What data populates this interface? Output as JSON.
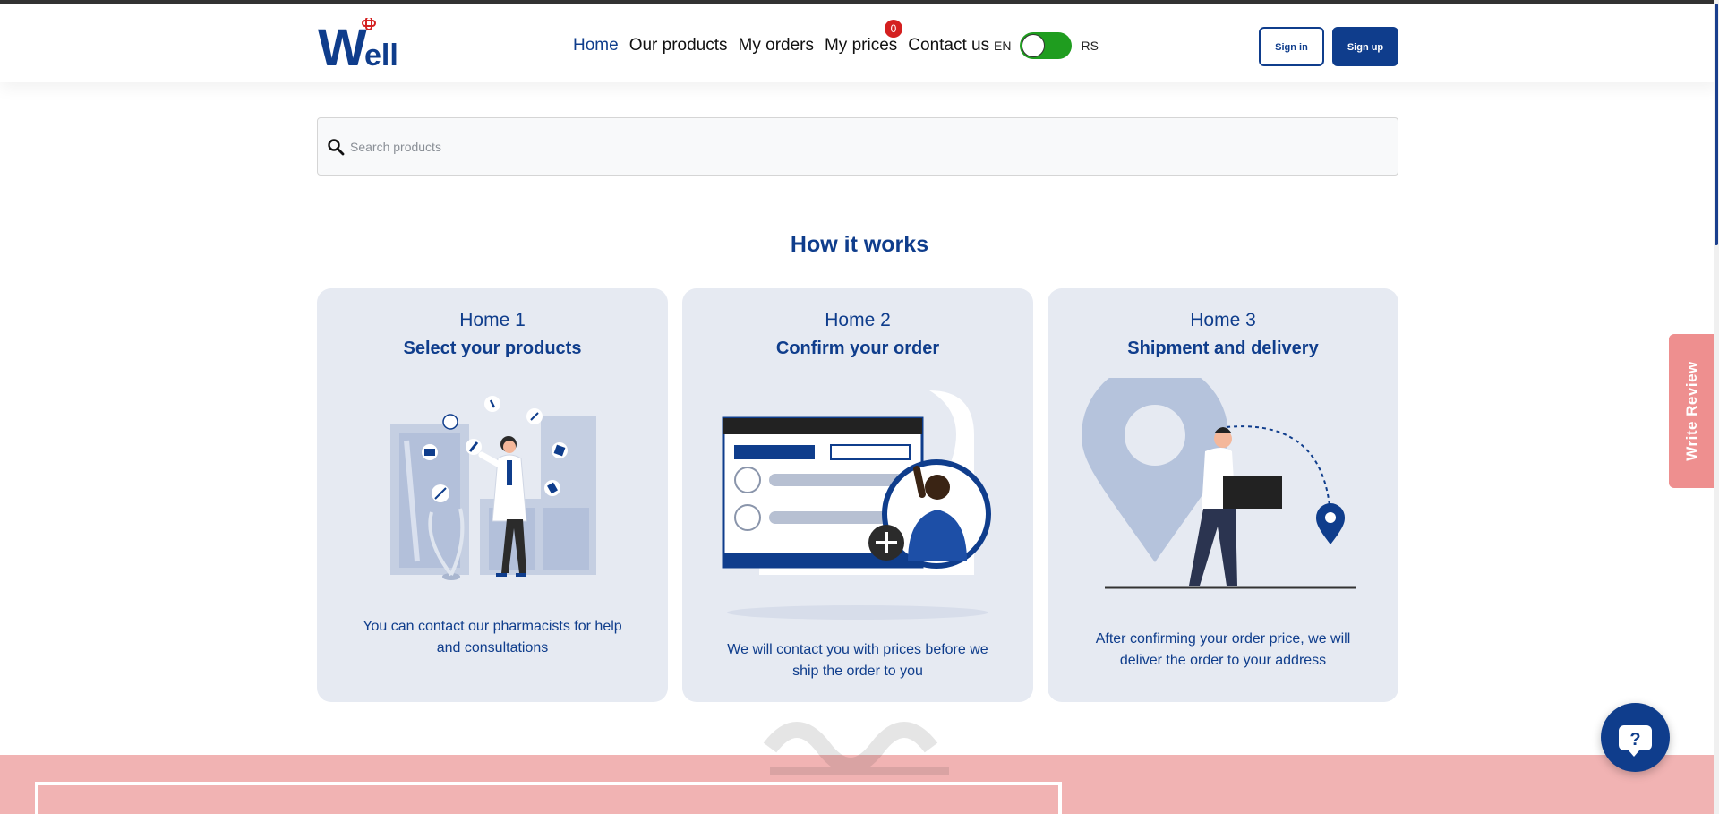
{
  "colors": {
    "brand": "#0f3d8c",
    "accent_red": "#d42020",
    "toggle_green": "#1f9d1f",
    "card_bg": "#e6eaf2",
    "pink_band": "#f1b3b3",
    "review_tab": "#ee8f8f"
  },
  "logo": {
    "text": "Well",
    "icon": "medical-cross-icon"
  },
  "nav": {
    "items": [
      {
        "label": "Home",
        "active": true
      },
      {
        "label": "Our products",
        "active": false
      },
      {
        "label": "My orders",
        "active": false
      },
      {
        "label": "My prices",
        "active": false,
        "badge": "0"
      },
      {
        "label": "Contact us",
        "active": false
      }
    ]
  },
  "language": {
    "left": "EN",
    "right": "RS"
  },
  "auth": {
    "sign_in": "Sign in",
    "sign_up": "Sign up"
  },
  "search": {
    "placeholder": "Search products",
    "value": "",
    "icon": "search-icon"
  },
  "how_it_works": {
    "title": "How it works",
    "cards": [
      {
        "number": "Home 1",
        "title": "Select your products",
        "description": "You can contact our pharmacists for help and consultations"
      },
      {
        "number": "Home 2",
        "title": "Confirm your order",
        "description": "We will contact you with prices before we ship the order to you"
      },
      {
        "number": "Home 3",
        "title": "Shipment and delivery",
        "description": "After confirming your order price, we will deliver the order to your address"
      }
    ]
  },
  "review_tab": {
    "label": "Write Review"
  },
  "help_button": {
    "icon": "help-question-icon"
  }
}
